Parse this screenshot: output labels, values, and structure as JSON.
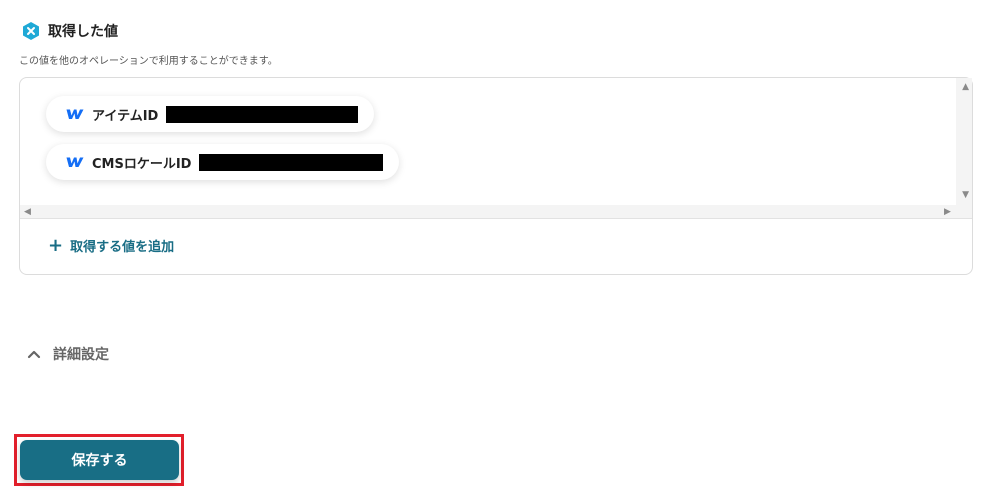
{
  "section": {
    "title": "取得した値",
    "description": "この値を他のオペレーションで利用することができます。"
  },
  "values": [
    {
      "label": "アイテムID"
    },
    {
      "label": "CMSロケールID"
    }
  ],
  "add_value_label": "取得する値を追加",
  "advanced": {
    "label": "詳細設定"
  },
  "save_button_label": "保存する",
  "colors": {
    "accent": "#186e85",
    "hex_icon": "#1fa9d6",
    "webflow_logo": "#146ef5",
    "highlight": "#e21f2b"
  }
}
